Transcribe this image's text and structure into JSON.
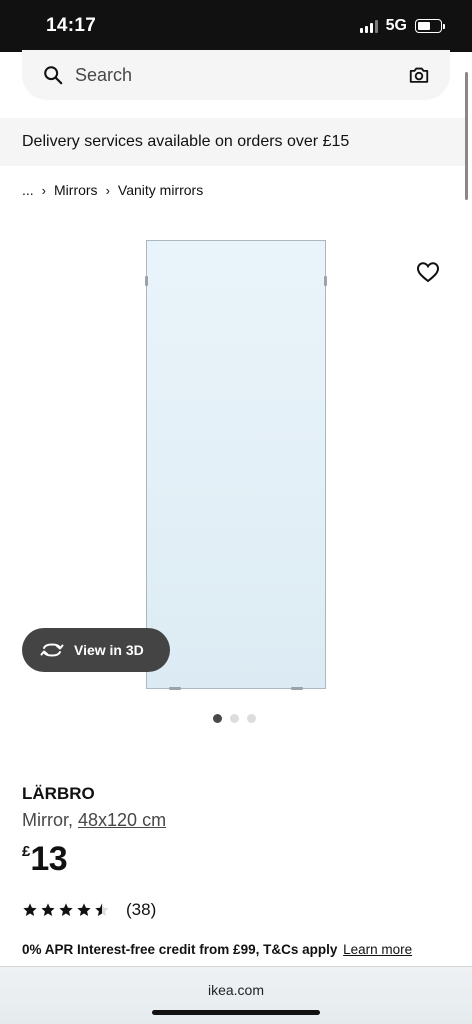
{
  "status_bar": {
    "time": "14:17",
    "network": "5G"
  },
  "search": {
    "placeholder": "Search"
  },
  "banner": {
    "text": "Delivery services available on orders over £15"
  },
  "breadcrumb": {
    "ellipsis": "...",
    "items": [
      "Mirrors",
      "Vanity mirrors"
    ]
  },
  "gallery": {
    "view3d_label": "View in 3D",
    "image_count": 3,
    "active_index": 0
  },
  "product": {
    "name": "LÄRBRO",
    "type": "Mirror,",
    "size": "48x120 cm",
    "currency": "£",
    "price": "13",
    "rating_value": 4.5,
    "rating_count": "(38)",
    "credit_text": "0% APR Interest-free credit from £99, T&Cs apply",
    "credit_link": "Learn more"
  },
  "browser": {
    "url": "ikea.com"
  },
  "colors": {
    "status_bg": "#111111",
    "surface_grey": "#f5f5f5",
    "button_dark": "#444444",
    "text_primary": "#111111",
    "text_secondary": "#484848"
  }
}
